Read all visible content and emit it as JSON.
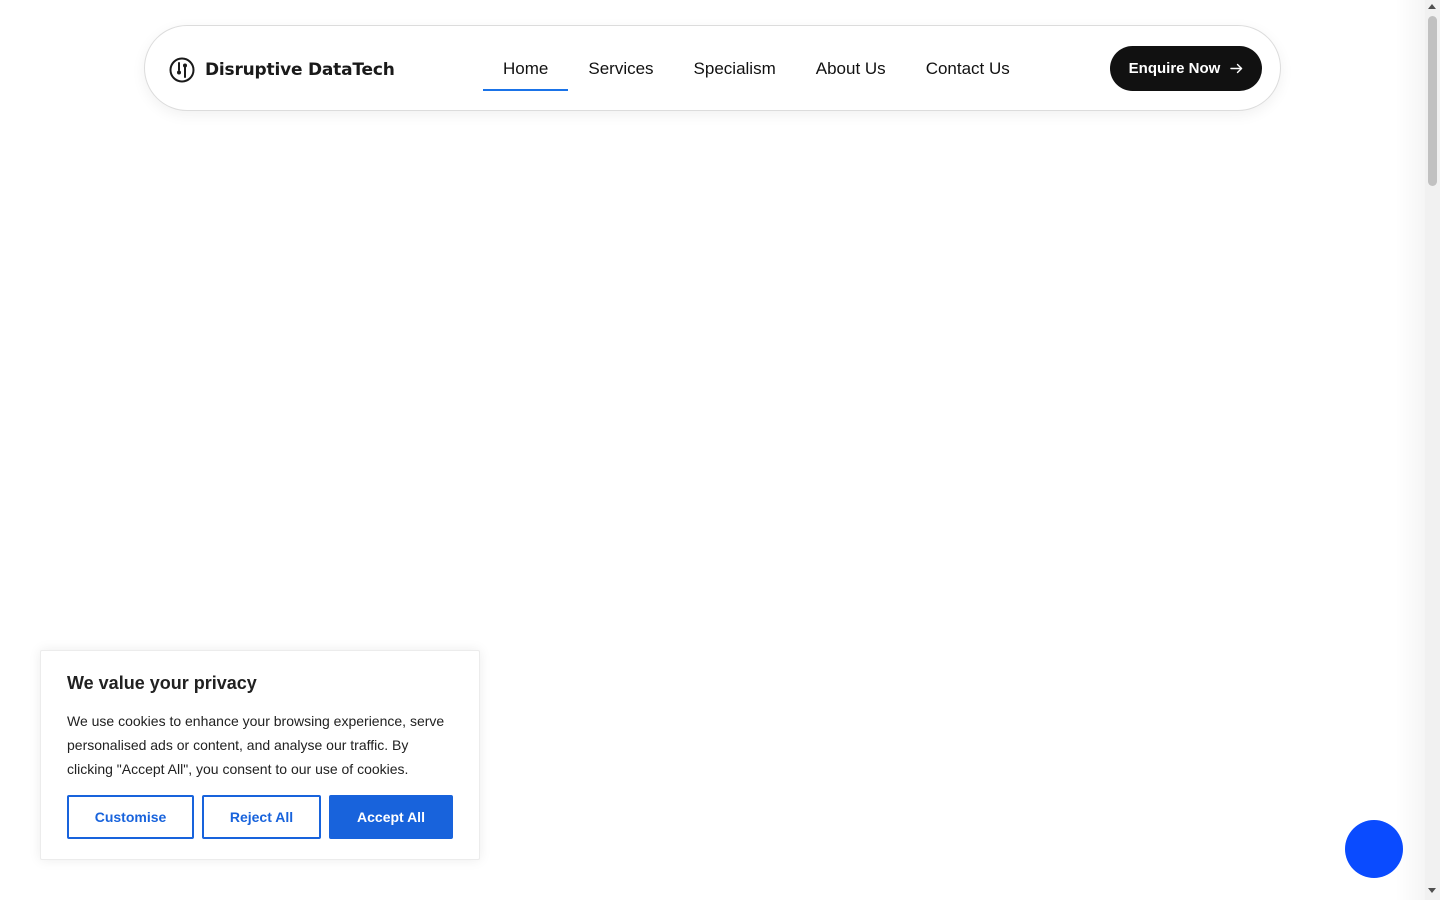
{
  "header": {
    "logo_text": "Disruptive DataTech",
    "logo_icon": "power-knob-icon",
    "nav": [
      {
        "label": "Home",
        "active": true
      },
      {
        "label": "Services",
        "active": false
      },
      {
        "label": "Specialism",
        "active": false
      },
      {
        "label": "About Us",
        "active": false
      },
      {
        "label": "Contact Us",
        "active": false
      }
    ],
    "cta_label": "Enquire Now",
    "cta_icon": "arrow-right-icon"
  },
  "cookie_banner": {
    "title": "We value your privacy",
    "body": "We use cookies to enhance your browsing experience, serve personalised ads or content, and analyse our traffic. By clicking \"Accept All\", you consent to our use of cookies.",
    "customise_label": "Customise",
    "reject_label": "Reject All",
    "accept_label": "Accept All"
  },
  "colors": {
    "accent": "#1a73e8",
    "cookie_blue": "#1863dc",
    "cta_bg": "#111111",
    "floating_button": "#0a4bff"
  }
}
